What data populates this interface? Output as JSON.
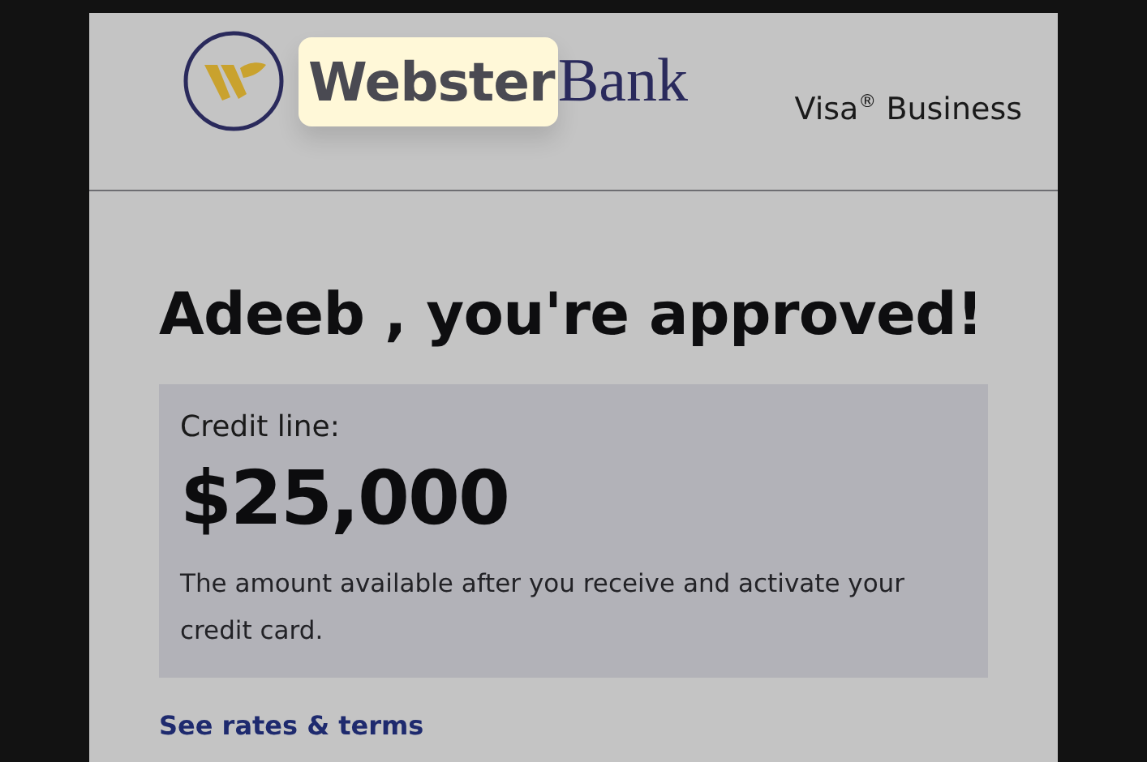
{
  "header": {
    "logo": {
      "name_part": "Webster",
      "name_part_highlighted": true,
      "bank_part": "Bank"
    },
    "product": "Visa$^{®}$ Business"
  },
  "heading": "Adeeb , you're approved!",
  "credit_box": {
    "label": "Credit line:",
    "amount": "$25,000",
    "note": "The amount available after you receive and activate your credit card."
  },
  "link": "See rates & terms"
}
